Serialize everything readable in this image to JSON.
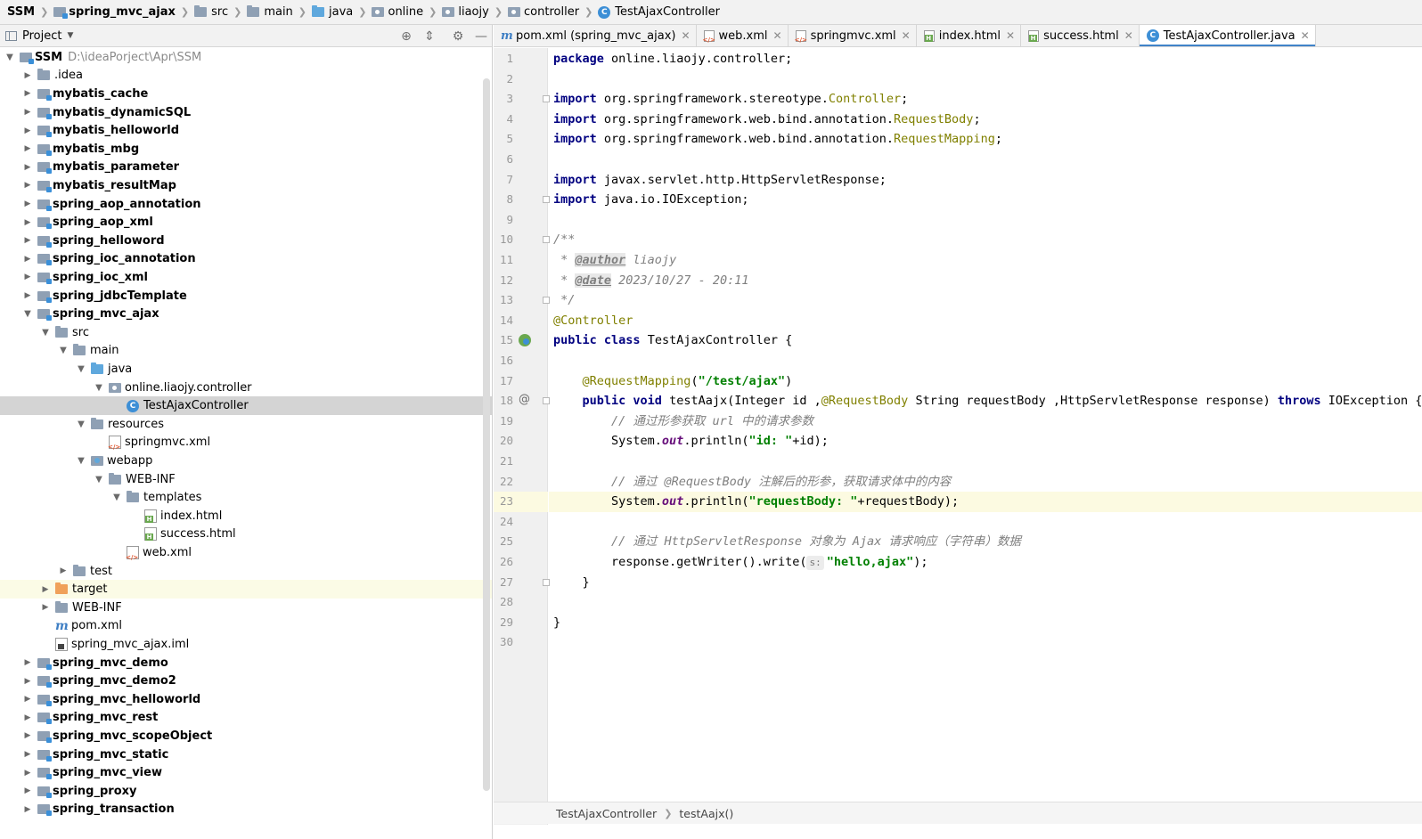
{
  "navbar": {
    "crumbs": [
      "SSM",
      "spring_mvc_ajax",
      "src",
      "main",
      "java",
      "online",
      "liaojy",
      "controller",
      "TestAjaxController"
    ]
  },
  "project_panel": {
    "title": "Project",
    "tree": [
      {
        "label": "SSM",
        "path": "D:\\ideaPorject\\Apr\\SSM",
        "depth": 0,
        "arrow": "down",
        "icon": "module",
        "bold": true
      },
      {
        "label": ".idea",
        "depth": 1,
        "arrow": "right",
        "icon": "folder"
      },
      {
        "label": "mybatis_cache",
        "depth": 1,
        "arrow": "right",
        "icon": "module",
        "bold": true
      },
      {
        "label": "mybatis_dynamicSQL",
        "depth": 1,
        "arrow": "right",
        "icon": "module",
        "bold": true
      },
      {
        "label": "mybatis_helloworld",
        "depth": 1,
        "arrow": "right",
        "icon": "module",
        "bold": true
      },
      {
        "label": "mybatis_mbg",
        "depth": 1,
        "arrow": "right",
        "icon": "module",
        "bold": true
      },
      {
        "label": "mybatis_parameter",
        "depth": 1,
        "arrow": "right",
        "icon": "module",
        "bold": true
      },
      {
        "label": "mybatis_resultMap",
        "depth": 1,
        "arrow": "right",
        "icon": "module",
        "bold": true
      },
      {
        "label": "spring_aop_annotation",
        "depth": 1,
        "arrow": "right",
        "icon": "module",
        "bold": true
      },
      {
        "label": "spring_aop_xml",
        "depth": 1,
        "arrow": "right",
        "icon": "module",
        "bold": true
      },
      {
        "label": "spring_helloword",
        "depth": 1,
        "arrow": "right",
        "icon": "module",
        "bold": true
      },
      {
        "label": "spring_ioc_annotation",
        "depth": 1,
        "arrow": "right",
        "icon": "module",
        "bold": true
      },
      {
        "label": "spring_ioc_xml",
        "depth": 1,
        "arrow": "right",
        "icon": "module",
        "bold": true
      },
      {
        "label": "spring_jdbcTemplate",
        "depth": 1,
        "arrow": "right",
        "icon": "module",
        "bold": true
      },
      {
        "label": "spring_mvc_ajax",
        "depth": 1,
        "arrow": "down",
        "icon": "module",
        "bold": true
      },
      {
        "label": "src",
        "depth": 2,
        "arrow": "down",
        "icon": "folder"
      },
      {
        "label": "main",
        "depth": 3,
        "arrow": "down",
        "icon": "folder"
      },
      {
        "label": "java",
        "depth": 4,
        "arrow": "down",
        "icon": "folder-blue"
      },
      {
        "label": "online.liaojy.controller",
        "depth": 5,
        "arrow": "down",
        "icon": "package"
      },
      {
        "label": "TestAjaxController",
        "depth": 6,
        "arrow": "none",
        "icon": "class",
        "selected": true
      },
      {
        "label": "resources",
        "depth": 4,
        "arrow": "down",
        "icon": "folder"
      },
      {
        "label": "springmvc.xml",
        "depth": 5,
        "arrow": "none",
        "icon": "xml"
      },
      {
        "label": "webapp",
        "depth": 4,
        "arrow": "down",
        "icon": "webapp"
      },
      {
        "label": "WEB-INF",
        "depth": 5,
        "arrow": "down",
        "icon": "folder"
      },
      {
        "label": "templates",
        "depth": 6,
        "arrow": "down",
        "icon": "folder"
      },
      {
        "label": "index.html",
        "depth": 7,
        "arrow": "none",
        "icon": "html"
      },
      {
        "label": "success.html",
        "depth": 7,
        "arrow": "none",
        "icon": "html"
      },
      {
        "label": "web.xml",
        "depth": 6,
        "arrow": "none",
        "icon": "xml"
      },
      {
        "label": "test",
        "depth": 3,
        "arrow": "right",
        "icon": "folder"
      },
      {
        "label": "target",
        "depth": 2,
        "arrow": "right",
        "icon": "folder-orange",
        "excluded": true
      },
      {
        "label": "WEB-INF",
        "depth": 2,
        "arrow": "right",
        "icon": "folder"
      },
      {
        "label": "pom.xml",
        "depth": 2,
        "arrow": "none",
        "icon": "maven"
      },
      {
        "label": "spring_mvc_ajax.iml",
        "depth": 2,
        "arrow": "none",
        "icon": "iml"
      },
      {
        "label": "spring_mvc_demo",
        "depth": 1,
        "arrow": "right",
        "icon": "module",
        "bold": true
      },
      {
        "label": "spring_mvc_demo2",
        "depth": 1,
        "arrow": "right",
        "icon": "module",
        "bold": true
      },
      {
        "label": "spring_mvc_helloworld",
        "depth": 1,
        "arrow": "right",
        "icon": "module",
        "bold": true
      },
      {
        "label": "spring_mvc_rest",
        "depth": 1,
        "arrow": "right",
        "icon": "module",
        "bold": true
      },
      {
        "label": "spring_mvc_scopeObject",
        "depth": 1,
        "arrow": "right",
        "icon": "module",
        "bold": true
      },
      {
        "label": "spring_mvc_static",
        "depth": 1,
        "arrow": "right",
        "icon": "module",
        "bold": true
      },
      {
        "label": "spring_mvc_view",
        "depth": 1,
        "arrow": "right",
        "icon": "module",
        "bold": true
      },
      {
        "label": "spring_proxy",
        "depth": 1,
        "arrow": "right",
        "icon": "module",
        "bold": true
      },
      {
        "label": "spring_transaction",
        "depth": 1,
        "arrow": "right",
        "icon": "module",
        "bold": true
      }
    ]
  },
  "editor": {
    "tabs": [
      {
        "label": "pom.xml (spring_mvc_ajax)",
        "icon": "maven"
      },
      {
        "label": "web.xml",
        "icon": "xml"
      },
      {
        "label": "springmvc.xml",
        "icon": "xml"
      },
      {
        "label": "index.html",
        "icon": "html"
      },
      {
        "label": "success.html",
        "icon": "html"
      },
      {
        "label": "TestAjaxController.java",
        "icon": "class",
        "active": true
      }
    ],
    "caret_line": 23,
    "lines": [
      [
        [
          "kw",
          "package"
        ],
        [
          "",
          "online.liaojy.controller;"
        ]
      ],
      [],
      [
        [
          "kw",
          "import"
        ],
        [
          "",
          "org.springframework.stereotype."
        ],
        [
          "ann",
          "Controller"
        ],
        [
          "",
          ";"
        ]
      ],
      [
        [
          "kw",
          "import"
        ],
        [
          "",
          "org.springframework.web.bind.annotation."
        ],
        [
          "ann",
          "RequestBody"
        ],
        [
          "",
          ";"
        ]
      ],
      [
        [
          "kw",
          "import"
        ],
        [
          "",
          "org.springframework.web.bind.annotation."
        ],
        [
          "ann",
          "RequestMapping"
        ],
        [
          "",
          ";"
        ]
      ],
      [],
      [
        [
          "kw",
          "import"
        ],
        [
          "",
          "javax.servlet.http.HttpServletResponse;"
        ]
      ],
      [
        [
          "kw",
          "import"
        ],
        [
          "",
          "java.io.IOException;"
        ]
      ],
      [],
      [
        [
          "cmt",
          "/**"
        ]
      ],
      [
        [
          "cmt",
          " * "
        ],
        [
          "tag",
          "@author"
        ],
        [
          "cmt",
          " liaojy"
        ]
      ],
      [
        [
          "cmt",
          " * "
        ],
        [
          "tag",
          "@date"
        ],
        [
          "cmt",
          " 2023/10/27 - 20:11"
        ]
      ],
      [
        [
          "cmt",
          " */"
        ]
      ],
      [
        [
          "ann",
          "@Controller"
        ]
      ],
      [
        [
          "kw",
          "public class"
        ],
        [
          "",
          "TestAjaxController {"
        ]
      ],
      [],
      [
        [
          "",
          "    "
        ],
        [
          "ann",
          "@RequestMapping"
        ],
        [
          "",
          "("
        ],
        [
          "str",
          "\"/test/ajax\""
        ],
        [
          "",
          ")"
        ]
      ],
      [
        [
          "",
          "    "
        ],
        [
          "kw",
          "public void"
        ],
        [
          "",
          "testAajx(Integer id ,"
        ],
        [
          "ann",
          "@RequestBody"
        ],
        [
          "",
          "String requestBody ,HttpServletResponse response) "
        ],
        [
          "kw",
          "throws"
        ],
        [
          "",
          "IOException {"
        ]
      ],
      [
        [
          "cmt",
          "        // 通过形参获取 url 中的请求参数"
        ]
      ],
      [
        [
          "",
          "        System."
        ],
        [
          "fld",
          "out"
        ],
        [
          "",
          ".println("
        ],
        [
          "str",
          "\"id: \""
        ],
        [
          "",
          "+id);"
        ]
      ],
      [],
      [
        [
          "cmt",
          "        // 通过 @RequestBody 注解后的形参，获取请求体中的内容"
        ]
      ],
      [
        [
          "",
          "        System."
        ],
        [
          "fld",
          "out"
        ],
        [
          "",
          ".println("
        ],
        [
          "str",
          "\"requestBody: \""
        ],
        [
          "",
          "+requestBody);"
        ]
      ],
      [],
      [
        [
          "cmt",
          "        // 通过 HttpServletResponse 对象为 Ajax 请求响应（字符串）数据"
        ]
      ],
      [
        [
          "",
          "        response.getWriter().write("
        ],
        [
          "hint",
          "s:"
        ],
        [
          "str",
          "\"hello,ajax\""
        ],
        [
          "",
          ");"
        ]
      ],
      [
        [
          "",
          "    }"
        ]
      ],
      [],
      [
        [
          "",
          "}"
        ]
      ],
      []
    ],
    "fold_lines": [
      3,
      8,
      10,
      13,
      18,
      27
    ],
    "bean_line": 15,
    "at_line": 18,
    "bottom_crumbs": [
      "TestAjaxController",
      "testAajx()"
    ]
  }
}
